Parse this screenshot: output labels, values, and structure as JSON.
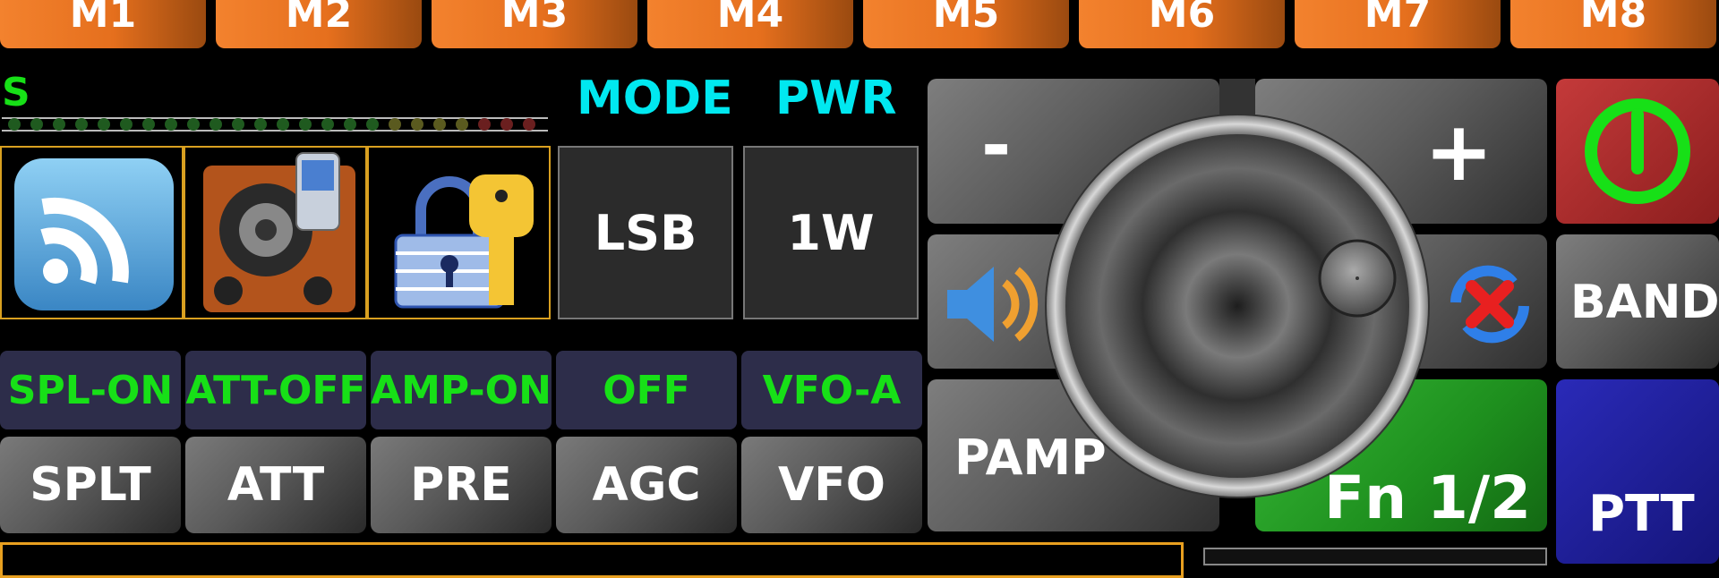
{
  "memories": [
    "M1",
    "M2",
    "M3",
    "M4",
    "M5",
    "M6",
    "M7",
    "M8"
  ],
  "meter": {
    "label": "S"
  },
  "labels": {
    "mode": "MODE",
    "pwr": "PWR"
  },
  "values": {
    "mode": "LSB",
    "pwr": "1W"
  },
  "icons": [
    "wifi-icon",
    "speaker-phone-icon",
    "lock-key-icon"
  ],
  "status": [
    "SPL-ON",
    "ATT-OFF",
    "AMP-ON",
    "OFF",
    "VFO-A"
  ],
  "buttons": [
    "SPLT",
    "ATT",
    "PRE",
    "AGC",
    "VFO"
  ],
  "right": {
    "minus": "-",
    "plus": "+",
    "pamp": "PAMP",
    "fn": "Fn 1/2",
    "band": "BAND",
    "ptt": "PTT"
  },
  "colors": {
    "accent_orange": "#f3822e",
    "status_green": "#17e017",
    "label_cyan": "#00e8f0",
    "fn_green": "#1e9a1e",
    "ptt_blue": "#1b1ba0",
    "power_red": "#a82828"
  }
}
